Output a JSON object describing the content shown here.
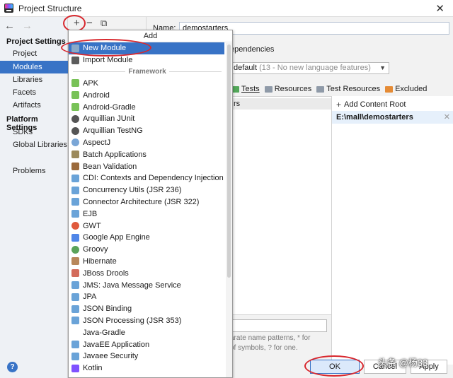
{
  "window": {
    "title": "Project Structure",
    "close_glyph": "✕"
  },
  "nav": {
    "back_glyph": "←",
    "forward_glyph": "→"
  },
  "toolbar": {
    "add_glyph": "+",
    "remove_glyph": "−",
    "copy_glyph": "⧉"
  },
  "sidebar": {
    "project_settings_head": "Project Settings",
    "platform_settings_head": "Platform Settings",
    "items": {
      "project": "Project",
      "modules": "Modules",
      "libraries": "Libraries",
      "facets": "Facets",
      "artifacts": "Artifacts",
      "sdks": "SDKs",
      "global_libraries": "Global Libraries",
      "problems": "Problems"
    },
    "help_glyph": "?"
  },
  "module": {
    "name_label": "Name:",
    "name_value": "demostarters",
    "dependencies_tab": "ependencies",
    "language_level": "default",
    "language_level_detail": "(13 - No new language features)",
    "marks": {
      "tests": "Tests",
      "resources": "Resources",
      "test_resources": "Test Resources",
      "excluded": "Excluded"
    },
    "tree_row_text": "rs",
    "add_content_root": "Add Content Root",
    "content_root": "E:\\mall\\demostarters",
    "exclude_hint_line1": "arate name patterns, * for",
    "exclude_hint_line2": "of symbols, ? for one."
  },
  "buttons": {
    "ok": "OK",
    "cancel": "Cancel",
    "apply": "Apply"
  },
  "watermark": "头条 @杨33",
  "popup": {
    "title": "Add",
    "top_items": [
      {
        "label": "New Module",
        "icon": "module-folder-icon",
        "color": "#8aa9c8"
      },
      {
        "label": "Import Module",
        "icon": "import-icon",
        "color": "#5c5c5c"
      }
    ],
    "framework_head": "Framework",
    "frameworks": [
      {
        "label": "APK",
        "icon": "android-icon",
        "color": "#78c257"
      },
      {
        "label": "Android",
        "icon": "android-icon",
        "color": "#78c257"
      },
      {
        "label": "Android-Gradle",
        "icon": "android-icon",
        "color": "#78c257"
      },
      {
        "label": "Arquillian JUnit",
        "icon": "arquillian-icon",
        "color": "#555555"
      },
      {
        "label": "Arquillian TestNG",
        "icon": "arquillian-icon",
        "color": "#555555"
      },
      {
        "label": "AspectJ",
        "icon": "aspectj-icon",
        "color": "#7aa6d6"
      },
      {
        "label": "Batch Applications",
        "icon": "batch-icon",
        "color": "#9c8a5c"
      },
      {
        "label": "Bean Validation",
        "icon": "bean-icon",
        "color": "#9b6a3c"
      },
      {
        "label": "CDI: Contexts and Dependency Injection",
        "icon": "cdi-icon",
        "color": "#6aa3d8"
      },
      {
        "label": "Concurrency Utils (JSR 236)",
        "icon": "concurrency-icon",
        "color": "#6aa3d8"
      },
      {
        "label": "Connector Architecture (JSR 322)",
        "icon": "connector-icon",
        "color": "#6aa3d8"
      },
      {
        "label": "EJB",
        "icon": "ejb-icon",
        "color": "#6aa3d8"
      },
      {
        "label": "GWT",
        "icon": "gwt-icon",
        "color": "#e05a3c"
      },
      {
        "label": "Google App Engine",
        "icon": "appengine-icon",
        "color": "#4f86e8"
      },
      {
        "label": "Groovy",
        "icon": "groovy-icon",
        "color": "#5aa35a"
      },
      {
        "label": "Hibernate",
        "icon": "hibernate-icon",
        "color": "#b8875a"
      },
      {
        "label": "JBoss Drools",
        "icon": "drools-icon",
        "color": "#d36b5b"
      },
      {
        "label": "JMS: Java Message Service",
        "icon": "jms-icon",
        "color": "#6aa3d8"
      },
      {
        "label": "JPA",
        "icon": "jpa-icon",
        "color": "#6aa3d8"
      },
      {
        "label": "JSON Binding",
        "icon": "json-icon",
        "color": "#6aa3d8"
      },
      {
        "label": "JSON Processing (JSR 353)",
        "icon": "json-icon",
        "color": "#6aa3d8"
      },
      {
        "label": "Java-Gradle",
        "icon": "none",
        "color": "#ffffff"
      },
      {
        "label": "JavaEE Application",
        "icon": "javaee-icon",
        "color": "#6aa3d8"
      },
      {
        "label": "Javaee Security",
        "icon": "security-icon",
        "color": "#6aa3d8"
      },
      {
        "label": "Kotlin",
        "icon": "kotlin-icon",
        "color": "#7f52ff"
      }
    ]
  }
}
